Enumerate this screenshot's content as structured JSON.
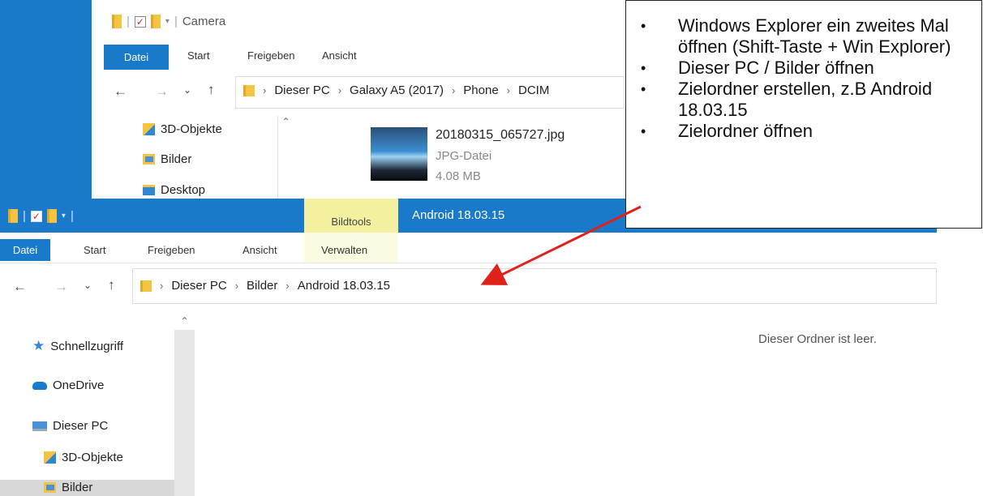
{
  "window_back": {
    "title": "Camera",
    "tabs": [
      "Datei",
      "Start",
      "Freigeben",
      "Ansicht"
    ],
    "breadcrumb": [
      "Dieser PC",
      "Galaxy A5 (2017)",
      "Phone",
      "DCIM"
    ],
    "sidebar": [
      {
        "label": "3D-Objekte",
        "icon": "3d-objects-icon"
      },
      {
        "label": "Bilder",
        "icon": "pictures-icon"
      },
      {
        "label": "Desktop",
        "icon": "desktop-icon"
      }
    ],
    "file": {
      "name": "20180315_065727.jpg",
      "type": "JPG-Datei",
      "size": "4.08 MB"
    }
  },
  "window_front": {
    "context_tab": "Bildtools",
    "title": "Android 18.03.15",
    "tabs": [
      "Datei",
      "Start",
      "Freigeben",
      "Ansicht",
      "Verwalten"
    ],
    "breadcrumb": [
      "Dieser PC",
      "Bilder",
      "Android 18.03.15"
    ],
    "sidebar": [
      {
        "label": "Schnellzugriff",
        "icon": "star-icon"
      },
      {
        "label": "OneDrive",
        "icon": "cloud-icon"
      },
      {
        "label": "Dieser PC",
        "icon": "pc-icon"
      },
      {
        "label": "3D-Objekte",
        "icon": "3d-objects-icon"
      },
      {
        "label": "Bilder",
        "icon": "pictures-icon"
      }
    ],
    "empty_message": "Dieser Ordner ist leer."
  },
  "annotation": {
    "items": [
      "Windows Explorer ein zweites Mal öffnen (Shift-Taste + Win Explorer)",
      "Dieser PC / Bilder öffnen",
      "Zielordner erstellen, z.B Android 18.03.15",
      "Zielordner öffnen"
    ],
    "arrow_color": "#e0201a"
  },
  "colors": {
    "accent": "#1979ca",
    "context_tab": "#f3f1a0"
  }
}
